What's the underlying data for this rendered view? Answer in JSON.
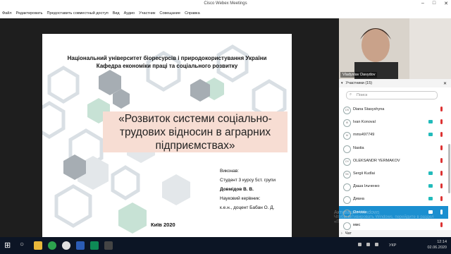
{
  "window": {
    "title": "Cisco Webex Meetings",
    "controls": [
      "–",
      "□",
      "✕"
    ]
  },
  "menu": {
    "items": [
      "Файл",
      "Редактировать",
      "Предоставить совместный доступ",
      "Вид",
      "Аудио",
      "Участник",
      "Совещание",
      "Справка"
    ]
  },
  "slide": {
    "header": [
      "Національний університет біоресурсів і природокористування України",
      "Кафедра економіки праці та соціального розвитку"
    ],
    "title": [
      "«Розвиток системи соціально-",
      "трудових відносин в аграрних",
      "підприємствах»"
    ],
    "meta": {
      "performed": "Виконав:",
      "student": "Студент 3 курсу 5ст. групи",
      "student_name": "Довмідов В. В.",
      "advisor_label": "Науковий керівник:",
      "advisor": "к.е.н., доцент Бaбан О. Д."
    },
    "city": "Київ 2020"
  },
  "sidebar": {
    "video_name": "Vladyslav Davydov",
    "participants_title": "Участники (15)",
    "search_placeholder": "Поиск",
    "participants": [
      {
        "initials": "DS",
        "name": "Diana Stasyshyna",
        "cam": false,
        "mic": "red",
        "active": false
      },
      {
        "initials": "IK",
        "name": "Ivan Konoval",
        "cam": true,
        "mic": "red",
        "active": false
      },
      {
        "initials": "M",
        "name": "mms497749",
        "cam": true,
        "mic": "red",
        "active": false
      },
      {
        "initials": "",
        "name": "Nastia",
        "cam": false,
        "mic": "red",
        "active": false
      },
      {
        "initials": "OY",
        "name": "OLEKSANDR YERMAKOV",
        "cam": false,
        "mic": "red",
        "active": false
      },
      {
        "initials": "SK",
        "name": "Sergii Kudlai",
        "cam": true,
        "mic": "red",
        "active": false
      },
      {
        "initials": "",
        "name": "Даша Ільченко",
        "cam": true,
        "mic": "red",
        "active": false
      },
      {
        "initials": "",
        "name": "Диана",
        "cam": true,
        "mic": "red",
        "active": false
      },
      {
        "initials": "",
        "name": "Оленка",
        "cam": true,
        "mic": "red",
        "active": true
      },
      {
        "initials": "",
        "name": "ммс",
        "cam": false,
        "mic": "red",
        "active": false
      }
    ],
    "chat_label": "Чат"
  },
  "taskbar": {
    "lang": "УКР",
    "time": "12:14",
    "date": "02.06.2020"
  },
  "watermark": {
    "line1": "Активация Windows",
    "line2": "Чтобы активировать Windows, перейдите в раздел",
    "line3": "«Параметры»."
  },
  "colors": {
    "slide_accent": "#f7ddd3",
    "active_row": "#1b8fd0",
    "mic_muted": "#dd3333",
    "camera": "#22bbbb"
  }
}
